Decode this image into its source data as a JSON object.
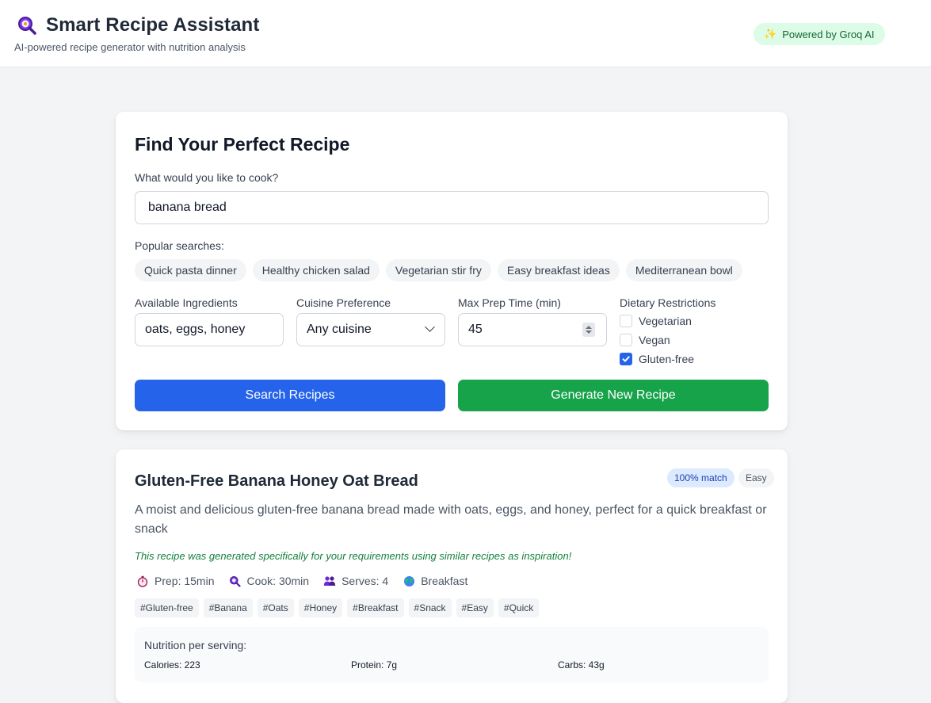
{
  "header": {
    "title": "Smart Recipe Assistant",
    "subtitle": "AI-powered recipe generator with nutrition analysis",
    "badge": "Powered by Groq AI",
    "logo_icon": "search-magnifier-icon",
    "badge_icon": "sparkle-icon"
  },
  "search": {
    "heading": "Find Your Perfect Recipe",
    "query_label": "What would you like to cook?",
    "query_value": "banana bread",
    "popular_label": "Popular searches:",
    "popular": [
      "Quick pasta dinner",
      "Healthy chicken salad",
      "Vegetarian stir fry",
      "Easy breakfast ideas",
      "Mediterranean bowl"
    ],
    "ingredients_label": "Available Ingredients",
    "ingredients_value": "oats, eggs, honey",
    "cuisine_label": "Cuisine Preference",
    "cuisine_value": "Any cuisine",
    "prep_label": "Max Prep Time (min)",
    "prep_value": "45",
    "dietary_label": "Dietary Restrictions",
    "dietary": [
      {
        "label": "Vegetarian",
        "checked": false
      },
      {
        "label": "Vegan",
        "checked": false
      },
      {
        "label": "Gluten-free",
        "checked": true
      }
    ],
    "search_button": "Search Recipes",
    "generate_button": "Generate New Recipe"
  },
  "recipe": {
    "title": "Gluten-Free Banana Honey Oat Bread",
    "match_badge": "100% match",
    "difficulty": "Easy",
    "description": "A moist and delicious gluten-free banana bread made with oats, eggs, and honey, perfect for a quick breakfast or snack",
    "note": "This recipe was generated specifically for your requirements using similar recipes as inspiration!",
    "meta": {
      "prep": "Prep: 15min",
      "cook": "Cook: 30min",
      "serves": "Serves: 4",
      "category": "Breakfast"
    },
    "tags": [
      "#Gluten-free",
      "#Banana",
      "#Oats",
      "#Honey",
      "#Breakfast",
      "#Snack",
      "#Easy",
      "#Quick"
    ],
    "nutrition_title": "Nutrition per serving:",
    "nutrition": {
      "calories": "Calories: 223",
      "protein": "Protein: 7g",
      "carbs": "Carbs: 43g"
    }
  },
  "colors": {
    "primary_blue": "#2563eb",
    "primary_green": "#16a34a",
    "badge_green_bg": "#dcfce7",
    "match_badge_bg": "#dbeafe"
  }
}
